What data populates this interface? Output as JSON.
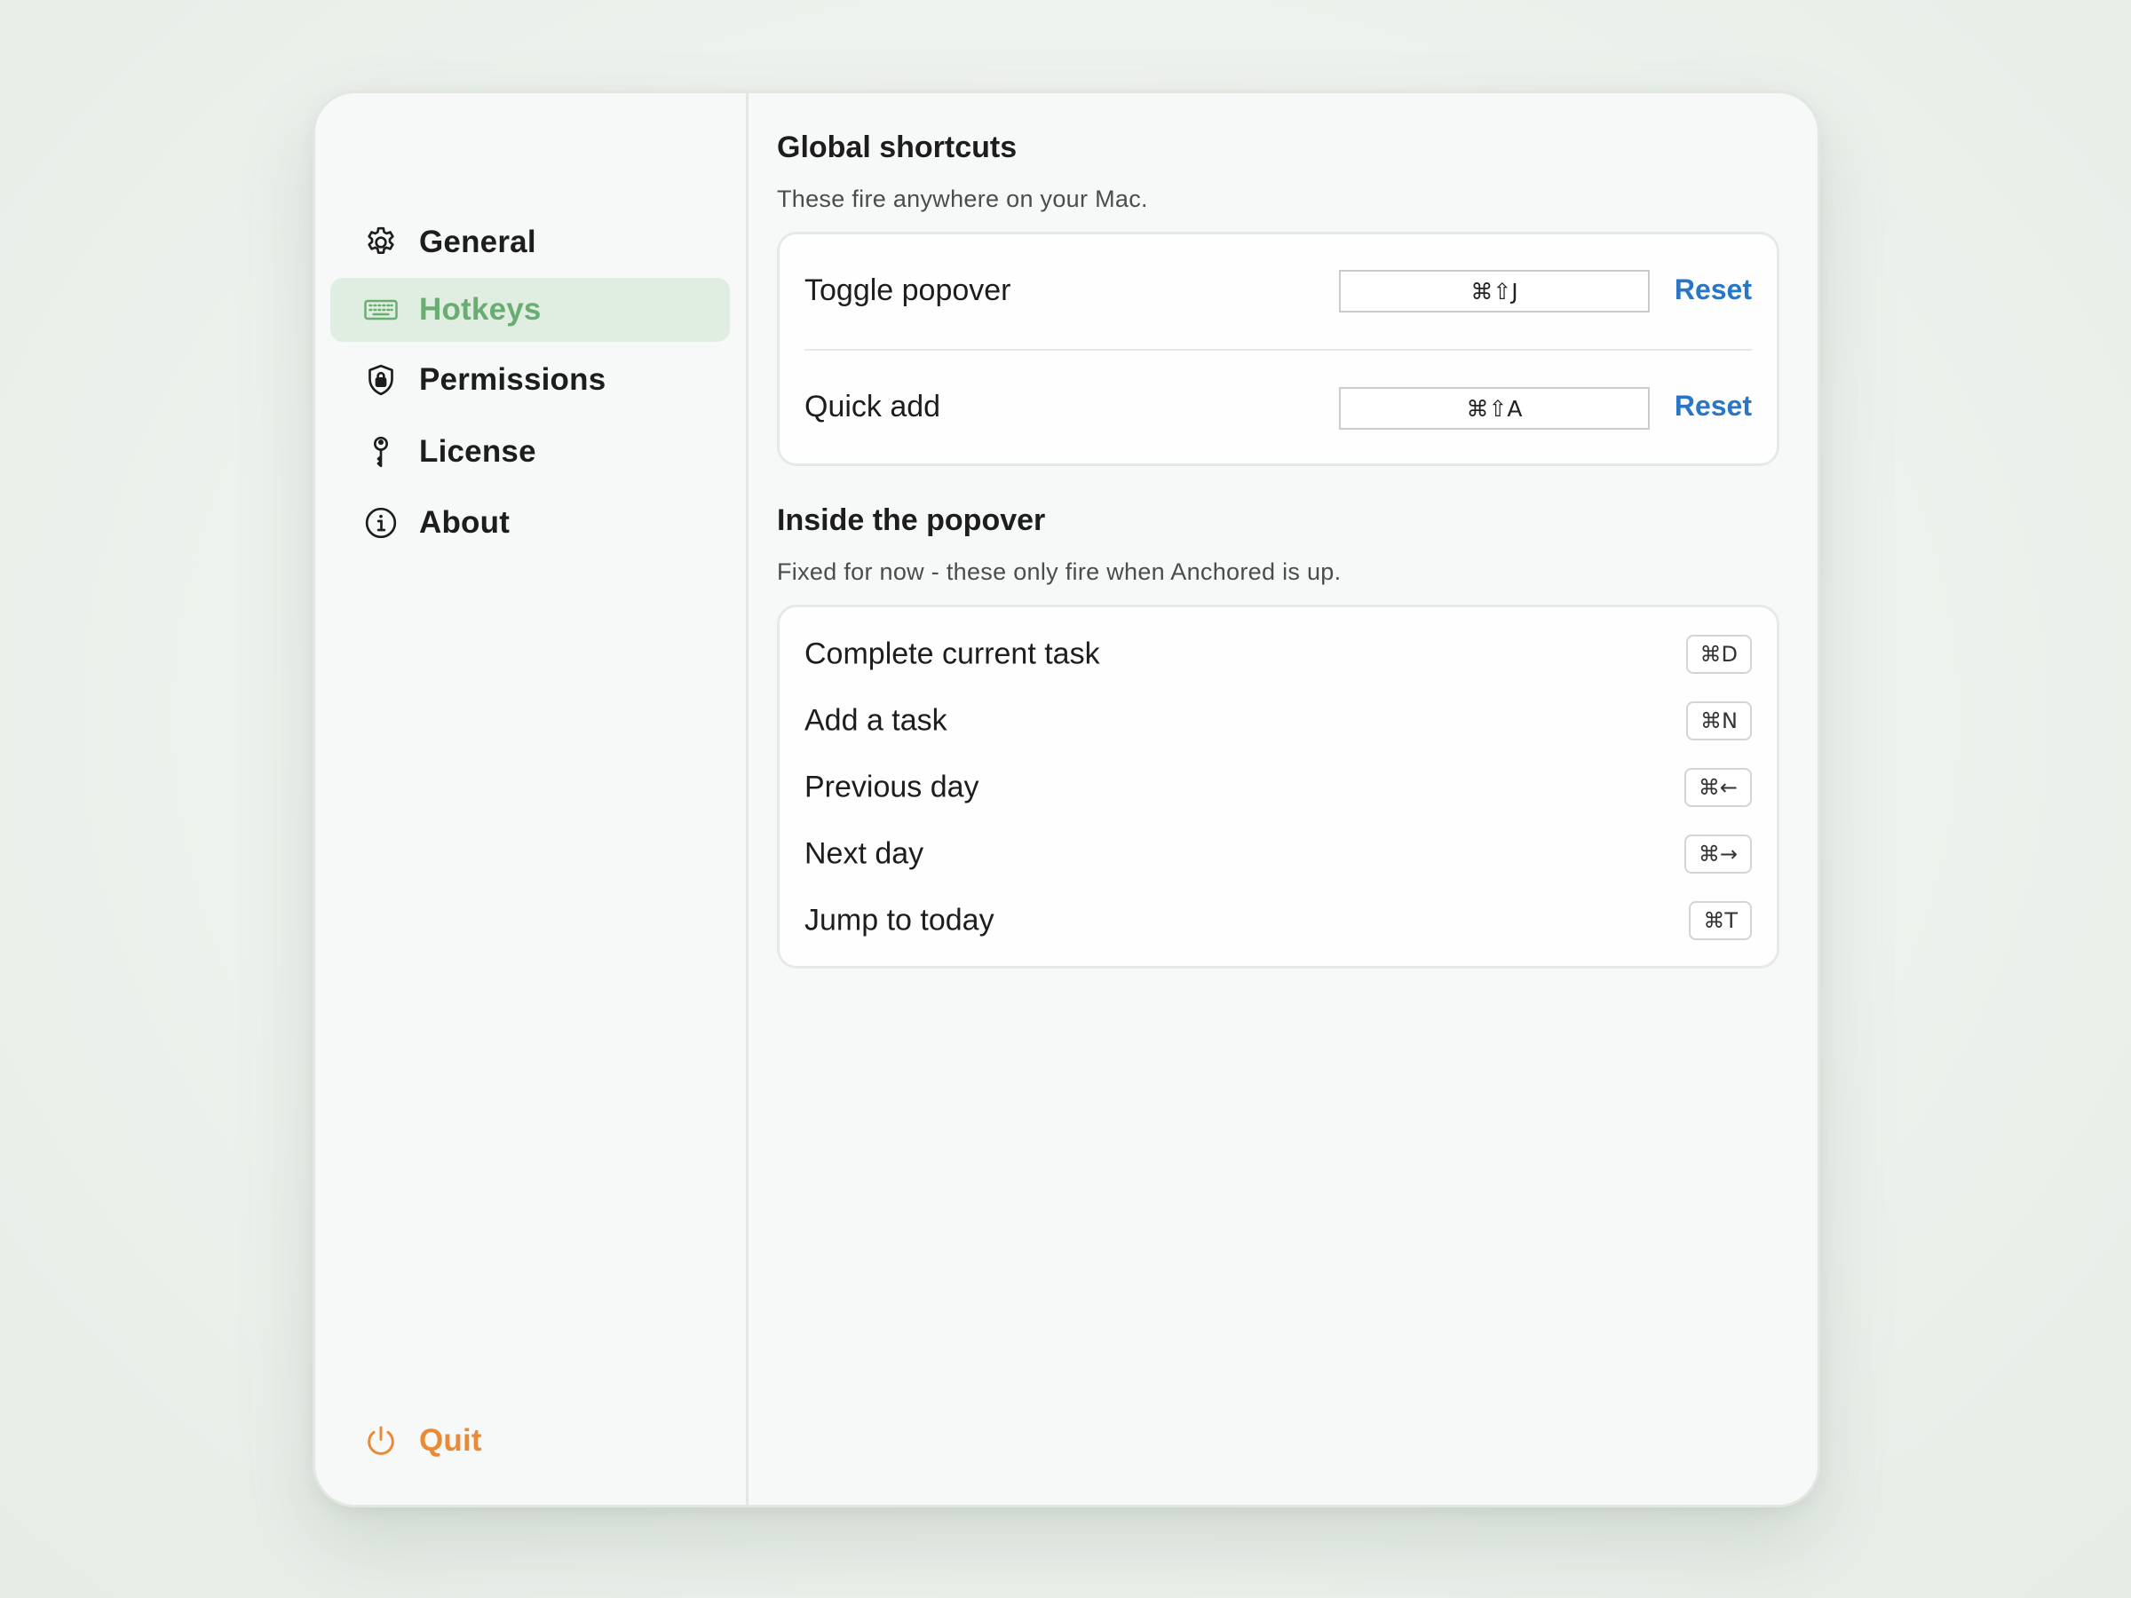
{
  "sidebar": {
    "items": [
      {
        "label": "General",
        "icon": "gear-icon",
        "active": false
      },
      {
        "label": "Hotkeys",
        "icon": "keyboard-icon",
        "active": true
      },
      {
        "label": "Permissions",
        "icon": "shield-icon",
        "active": false
      },
      {
        "label": "License",
        "icon": "key-icon",
        "active": false
      },
      {
        "label": "About",
        "icon": "info-icon",
        "active": false
      }
    ],
    "quit": {
      "label": "Quit",
      "icon": "power-icon"
    }
  },
  "colors": {
    "active_accent": "#6aad72",
    "active_background": "#e0ede1",
    "quit_accent": "#e88a36",
    "link": "#2a76c6"
  },
  "global": {
    "title": "Global shortcuts",
    "subtitle": "These fire anywhere on your Mac.",
    "rows": [
      {
        "label": "Toggle popover",
        "shortcut": "⌘⇧J",
        "reset_label": "Reset"
      },
      {
        "label": "Quick add",
        "shortcut": "⌘⇧A",
        "reset_label": "Reset"
      }
    ]
  },
  "popover": {
    "title": "Inside the popover",
    "subtitle": "Fixed for now - these only fire when Anchored is up.",
    "rows": [
      {
        "label": "Complete current task",
        "shortcut": "⌘D"
      },
      {
        "label": "Add a task",
        "shortcut": "⌘N"
      },
      {
        "label": "Previous day",
        "shortcut": "⌘←"
      },
      {
        "label": "Next day",
        "shortcut": "⌘→"
      },
      {
        "label": "Jump to today",
        "shortcut": "⌘T"
      }
    ]
  }
}
